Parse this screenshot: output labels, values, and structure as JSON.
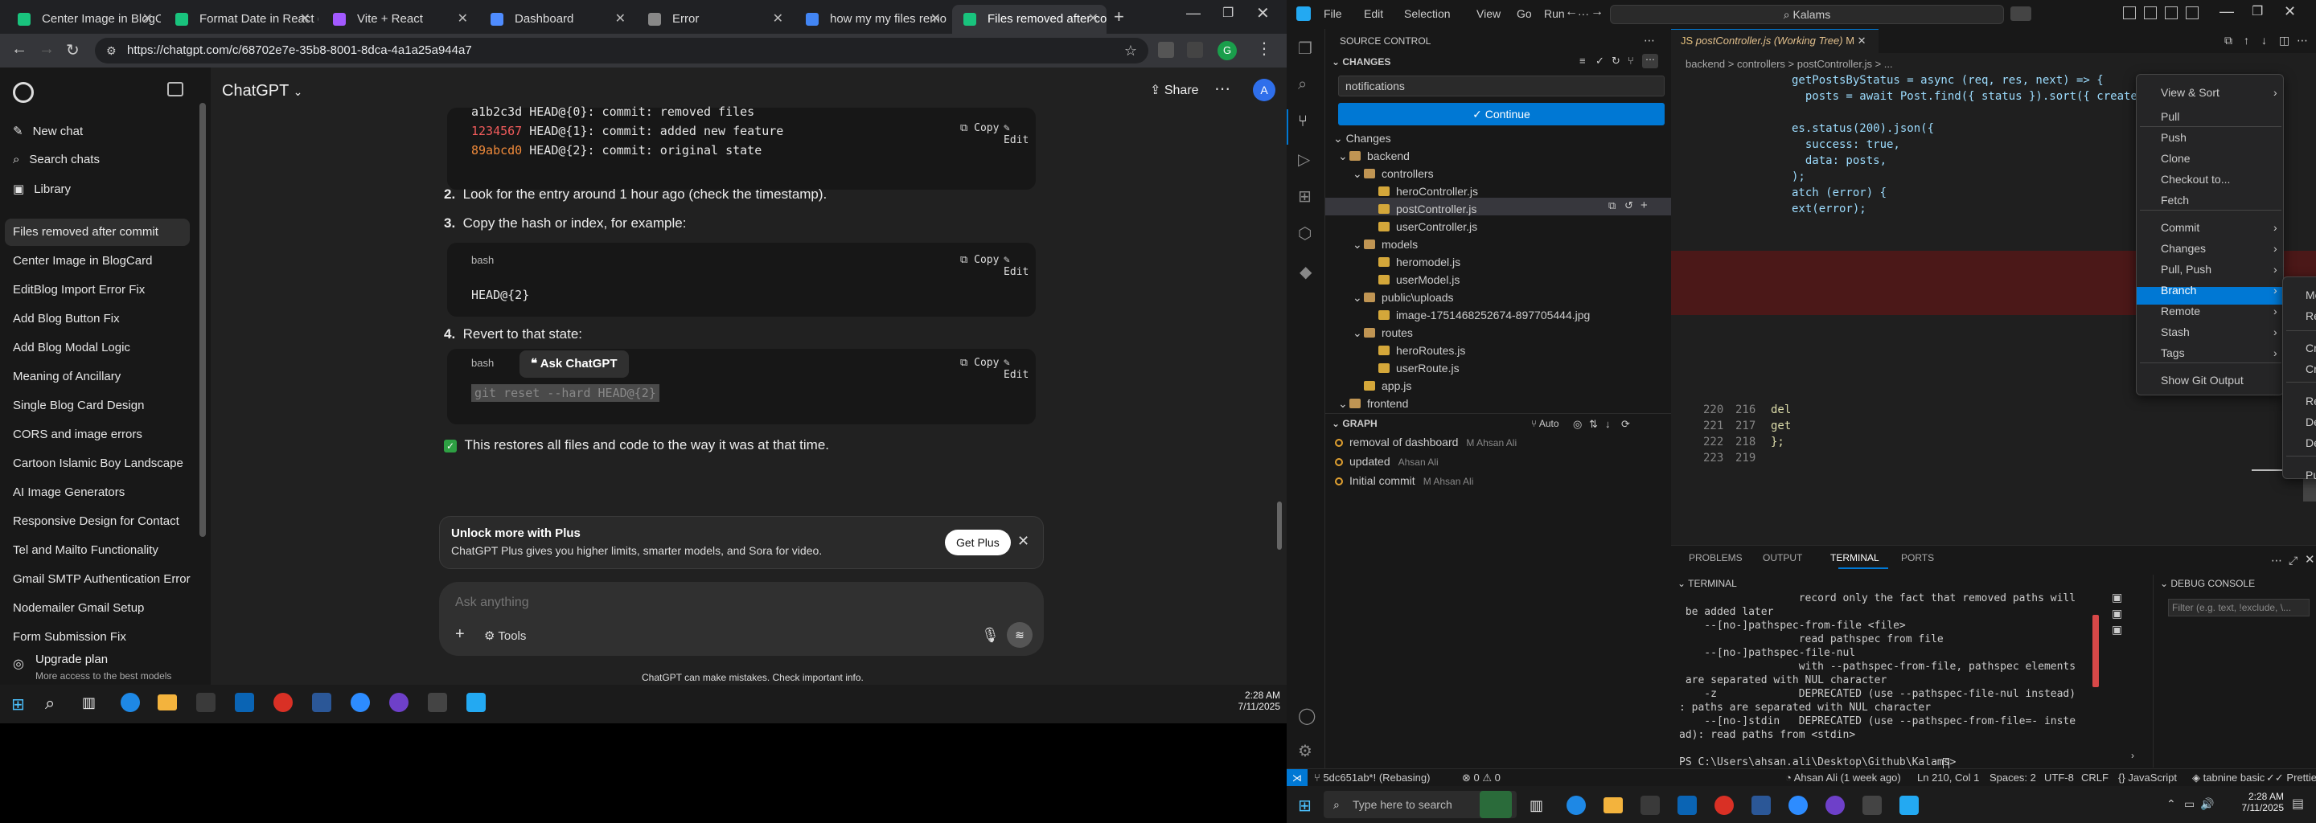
{
  "browser": {
    "tabs": [
      {
        "label": "Center Image in BlogC",
        "fav": "#19c37d"
      },
      {
        "label": "Format Date in React (",
        "fav": "#19c37d"
      },
      {
        "label": "Vite + React",
        "fav": "#a259ff"
      },
      {
        "label": "Dashboard",
        "fav": "#4f8cff"
      },
      {
        "label": "Error",
        "fav": "#888888"
      },
      {
        "label": "how my my files remo",
        "fav": "#4285f4"
      },
      {
        "label": "Files removed after co",
        "fav": "#19c37d"
      }
    ],
    "url": "https://chatgpt.com/c/68702e7e-35b8-8001-8dca-4a1a25a944a7"
  },
  "chatgpt": {
    "sidebar": {
      "new_chat": "New chat",
      "search": "Search chats",
      "library": "Library",
      "chats": [
        "Files removed after commit",
        "Center Image in BlogCard",
        "EditBlog Import Error Fix",
        "Add Blog Button Fix",
        "Add Blog Modal Logic",
        "Meaning of Ancillary",
        "Single Blog Card Design",
        "CORS and image errors",
        "Cartoon Islamic Boy Landscape",
        "AI Image Generators",
        "Responsive Design for Contact",
        "Tel and Mailto Functionality",
        "Gmail SMTP Authentication Error",
        "Nodemailer Gmail Setup",
        "Form Submission Fix"
      ],
      "upgrade_title": "Upgrade plan",
      "upgrade_sub": "More access to the best models"
    },
    "header": {
      "title": "ChatGPT",
      "share": "Share"
    },
    "reflog": [
      {
        "hash": "a1b2c3d",
        "rest": " HEAD@{0}: commit: removed files",
        "hashcolor": "#e6e6e6"
      },
      {
        "hash": "1234567",
        "rest": " HEAD@{1}: commit: added new feature",
        "hashcolor": "#f05b5b"
      },
      {
        "hash": "89abcd0",
        "rest": " HEAD@{2}: commit: original state",
        "hashcolor": "#f08a3a"
      }
    ],
    "copy": "Copy",
    "edit": "Edit",
    "steps": [
      {
        "num": "2.",
        "text": "Look for the entry around 1 hour ago (check the timestamp)."
      },
      {
        "num": "3.",
        "text": "Copy the hash or index, for example:"
      },
      {
        "num": "4.",
        "text": "Revert to that state:"
      }
    ],
    "bash": "bash",
    "head2": "HEAD@{2}",
    "reset_cmd": "git reset --hard HEAD@{2}",
    "ask": "Ask ChatGPT",
    "restores": "This restores all files and code to the way it was at that time.",
    "plus_title": "Unlock more with Plus",
    "plus_sub": "ChatGPT Plus gives you higher limits, smarter models, and Sora for video.",
    "get_plus": "Get Plus",
    "placeholder": "Ask anything",
    "tools": "Tools",
    "disclaimer": "ChatGPT can make mistakes. Check important info."
  },
  "taskbar_left": {
    "time": "2:28 AM",
    "date": "7/11/2025"
  },
  "vscode": {
    "menus": [
      "File",
      "Edit",
      "Selection",
      "View",
      "Go",
      "Run",
      "···"
    ],
    "search": "Kalams",
    "scm_title": "SOURCE CONTROL",
    "changes_label": "CHANGES",
    "commit_msg": "notifications",
    "continue": "Continue",
    "changes_group": "Changes",
    "tree": [
      {
        "name": "backend",
        "level": 1,
        "type": "folder"
      },
      {
        "name": "controllers",
        "level": 2,
        "type": "folder"
      },
      {
        "name": "heroController.js",
        "level": 3,
        "type": "file"
      },
      {
        "name": "postController.js",
        "level": 3,
        "type": "file"
      },
      {
        "name": "userController.js",
        "level": 3,
        "type": "file"
      },
      {
        "name": "models",
        "level": 2,
        "type": "folder"
      },
      {
        "name": "heromodel.js",
        "level": 3,
        "type": "file"
      },
      {
        "name": "userModel.js",
        "level": 3,
        "type": "file"
      },
      {
        "name": "public\\uploads",
        "level": 2,
        "type": "folder"
      },
      {
        "name": "image-1751468252674-897705444.jpg",
        "level": 3,
        "type": "file"
      },
      {
        "name": "routes",
        "level": 2,
        "type": "folder"
      },
      {
        "name": "heroRoutes.js",
        "level": 3,
        "type": "file"
      },
      {
        "name": "userRoute.js",
        "level": 3,
        "type": "file"
      },
      {
        "name": "app.js",
        "level": 2,
        "type": "file"
      },
      {
        "name": "frontend",
        "level": 1,
        "type": "folder"
      }
    ],
    "graph_title": "GRAPH",
    "graph_auto": "Auto",
    "commits": [
      {
        "msg": "removal of dashboard",
        "author": "M Ahsan Ali"
      },
      {
        "msg": "updated",
        "author": "Ahsan Ali"
      },
      {
        "msg": "Initial commit",
        "author": "M Ahsan Ali"
      }
    ],
    "editor_tab": "postController.js (Working Tree)",
    "editor_tab_badge": "M",
    "breadcrumb": "backend > controllers > postController.js > ...",
    "code": [
      "getPostsByStatus = async (req, res, next) => {",
      "  posts = await Post.find({ status }).sort({ createdAt: -1 });",
      "",
      "es.status(200).json({",
      "  success: true,",
      "  data: posts,",
      ");",
      "atch (error) {",
      "ext(error);"
    ],
    "code2": [
      {
        "a": "220",
        "b": "216",
        "t": "del"
      },
      {
        "a": "221",
        "b": "217",
        "t": "get"
      },
      {
        "a": "222",
        "b": "218",
        "t": "};"
      },
      {
        "a": "223",
        "b": "219",
        "t": ""
      }
    ],
    "menu1": [
      "View & Sort",
      "Pull",
      "Push",
      "Clone",
      "Checkout to...",
      "Fetch",
      "Commit",
      "Changes",
      "Pull, Push",
      "Branch",
      "Remote",
      "Stash",
      "Tags",
      "Show Git Output"
    ],
    "menu2": [
      "Merge...",
      "Rebase Branch...",
      "Create Branch...",
      "Create Branch From...",
      "Rename Branch...",
      "Delete Branch...",
      "Delete Remote Branch...",
      "Publish Branch..."
    ],
    "panel_tabs": [
      "PROBLEMS",
      "OUTPUT",
      "TERMINAL",
      "PORTS"
    ],
    "terminal_label": "TERMINAL",
    "debug_label": "DEBUG CONSOLE",
    "debug_filter": "Filter (e.g. text, !exclude, \\...",
    "term_lines": [
      "                   record only the fact that removed paths will",
      " be added later",
      "    --[no-]pathspec-from-file <file>",
      "                   read pathspec from file",
      "    --[no-]pathspec-file-nul",
      "                   with --pathspec-from-file, pathspec elements",
      " are separated with NUL character",
      "    -z             DEPRECATED (use --pathspec-file-nul instead)",
      ": paths are separated with NUL character",
      "    --[no-]stdin   DEPRECATED (use --pathspec-from-file=- inste",
      "ad): read paths from <stdin>",
      "",
      "PS C:\\Users\\ahsan.ali\\Desktop\\Github\\Kalams> "
    ],
    "status_branch": "5dc651ab*! (Rebasing)",
    "status_errors": "0",
    "status_warnings": "0",
    "status_author": "Ahsan Ali (1 week ago)",
    "status_pos": "Ln 210, Col 1",
    "status_spaces": "Spaces: 2",
    "status_enc": "UTF-8",
    "status_eol": "CRLF",
    "status_lang": "JavaScript",
    "status_tabnine": "tabnine basic",
    "status_prettier": "Prettier",
    "win_search": "Type here to search",
    "win_time": "2:28 AM",
    "win_date": "7/11/2025"
  }
}
